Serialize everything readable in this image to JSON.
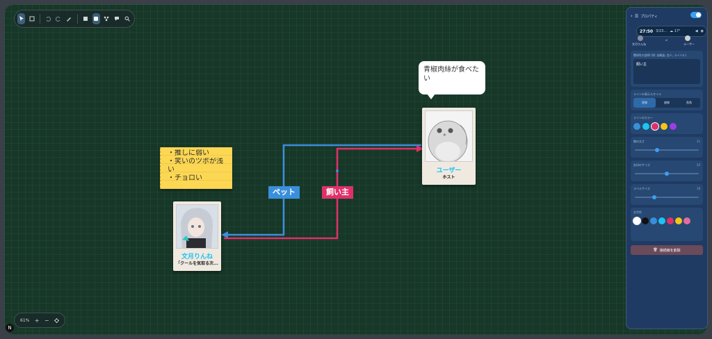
{
  "sticky_note": {
    "lines": [
      "・推しに弱い",
      "・笑いのツボが浅",
      "い",
      "・チョロい"
    ]
  },
  "speech_bubble": {
    "text": "青椒肉絲が食べたい"
  },
  "cards": {
    "user": {
      "name": "ユーザー",
      "role": "ホスト"
    },
    "character": {
      "name": "文月りんね",
      "role": "「クールを気取る次..."
    }
  },
  "connections": {
    "pet": {
      "label": "ペット",
      "color": "#3a8fdc"
    },
    "owner": {
      "label": "飼い主",
      "color": "#e0306a"
    }
  },
  "zoom": {
    "level": "61%",
    "plus": "+",
    "minus": "−"
  },
  "panel": {
    "title": "プロパティ",
    "time": "27:50",
    "time_meta": "3/23...",
    "weather": "☁ 17°",
    "endpoints": [
      "文月りんね",
      "ユーザー"
    ],
    "relation_label": "関係性の説明 (例: 幼馴染, 恋人, ライバル)",
    "relation_value": "飼い主",
    "line_style_label": "ラインの表示スタイル",
    "line_styles": [
      "直線",
      "曲線",
      "直角"
    ],
    "line_color_label": "ラインのカラー",
    "line_colors": [
      "#3a8fdc",
      "#1ec3f0",
      "#e0306a",
      "#f5c518",
      "#9b3fe0"
    ],
    "line_width_label": "線の太さ",
    "line_width_value": "11",
    "line_width_level": 0.35,
    "arrow_size_label": "矢印のサイズ",
    "arrow_size_value": "20",
    "arrow_size_level": 0.5,
    "label_size_label": "ラベルサイズ",
    "label_size_value": "18",
    "label_size_level": 0.3,
    "text_color_label": "文字色",
    "text_colors": [
      "#ffffff",
      "#111111",
      "#3a8fdc",
      "#1ec3f0",
      "#e0306a",
      "#f5c518",
      "#e66aa0"
    ],
    "delete_label": "接続線を削除"
  }
}
